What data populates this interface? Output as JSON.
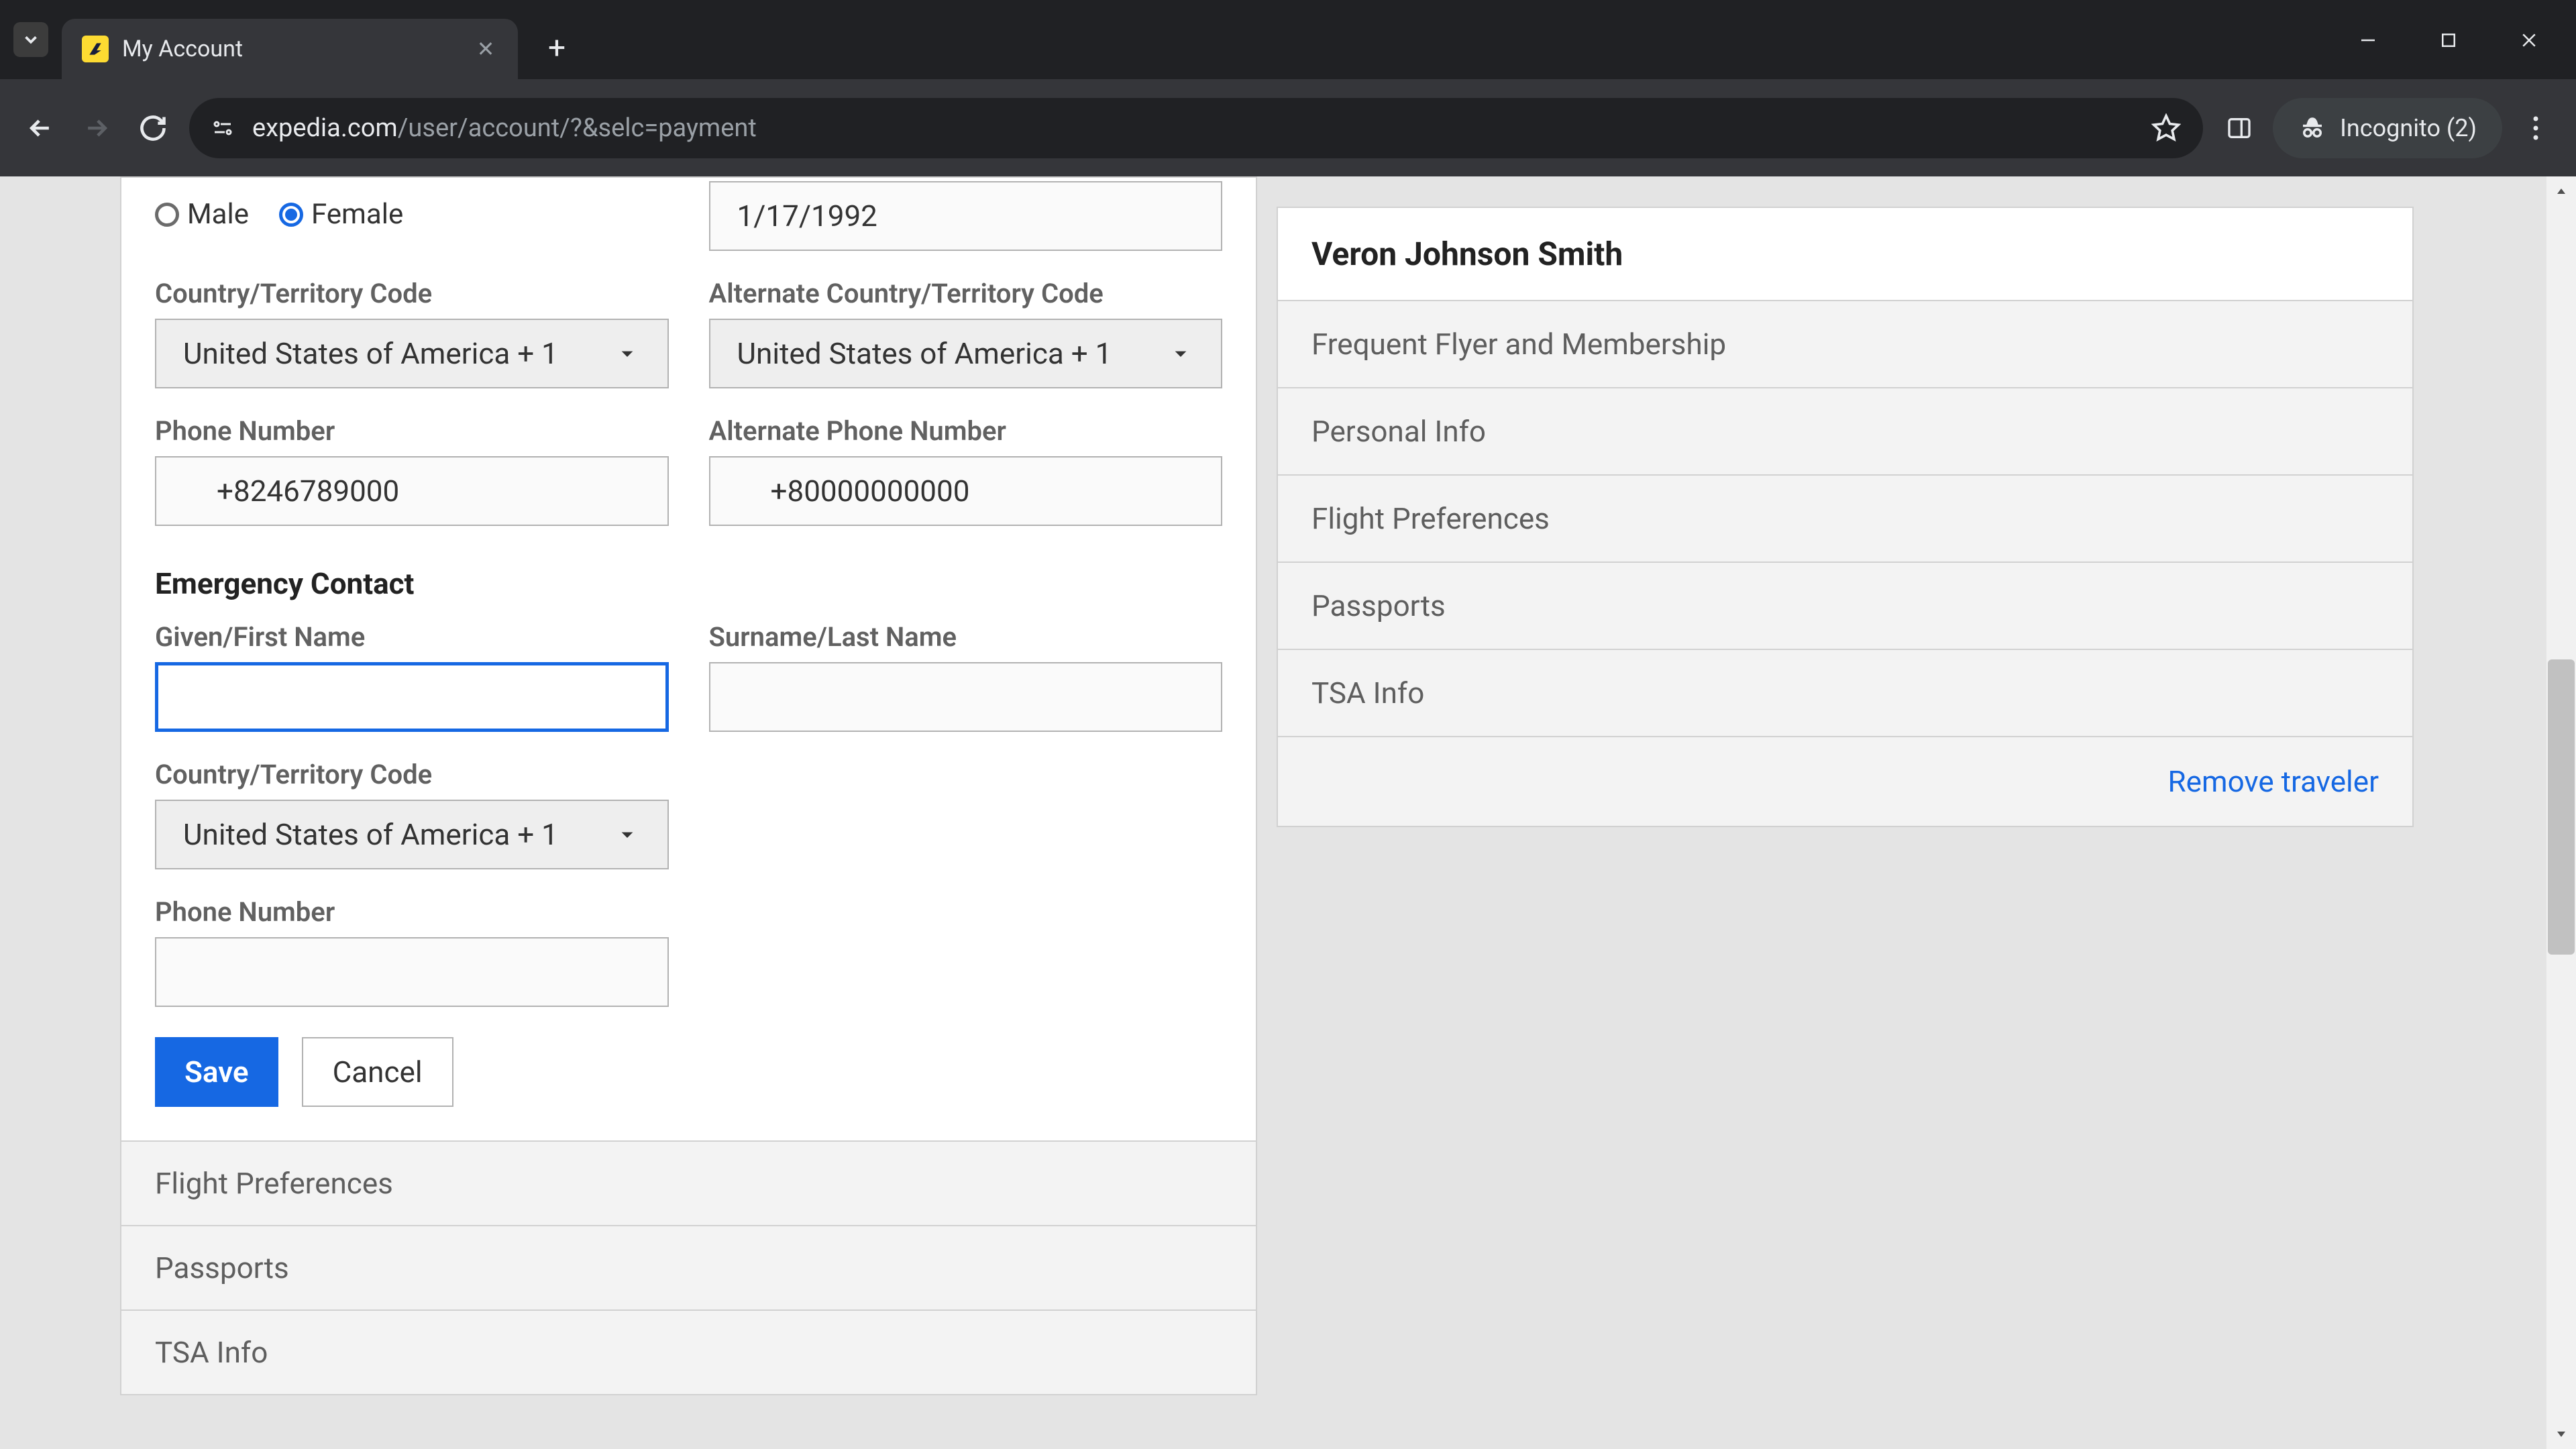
{
  "browser": {
    "tab_title": "My Account",
    "url_domain": "expedia.com",
    "url_path": "/user/account/?&selc=payment",
    "incognito_label": "Incognito (2)"
  },
  "form": {
    "gender": {
      "male_label": "Male",
      "female_label": "Female",
      "selected": "Female"
    },
    "dob_value": "1/17/1992",
    "country_code_label": "Country/Territory Code",
    "alt_country_code_label": "Alternate Country/Territory Code",
    "country_code_value": "United States of America + 1",
    "alt_country_code_value": "United States of America + 1",
    "phone_label": "Phone Number",
    "alt_phone_label": "Alternate Phone Number",
    "phone_value": "+8246789000",
    "alt_phone_value": "+80000000000",
    "emergency_heading": "Emergency Contact",
    "first_name_label": "Given/First Name",
    "last_name_label": "Surname/Last Name",
    "first_name_value": "",
    "last_name_value": "",
    "ec_country_code_label": "Country/Territory Code",
    "ec_country_code_value": "United States of America + 1",
    "ec_phone_label": "Phone Number",
    "ec_phone_value": "",
    "save_label": "Save",
    "cancel_label": "Cancel"
  },
  "main_accordion": {
    "flight_prefs": "Flight Preferences",
    "passports": "Passports",
    "tsa_info": "TSA Info"
  },
  "sidebar": {
    "traveler_name": "Veron Johnson Smith",
    "items": {
      "frequent_flyer": "Frequent Flyer and Membership",
      "personal_info": "Personal Info",
      "flight_prefs": "Flight Preferences",
      "passports": "Passports",
      "tsa_info": "TSA Info"
    },
    "remove_label": "Remove traveler"
  }
}
